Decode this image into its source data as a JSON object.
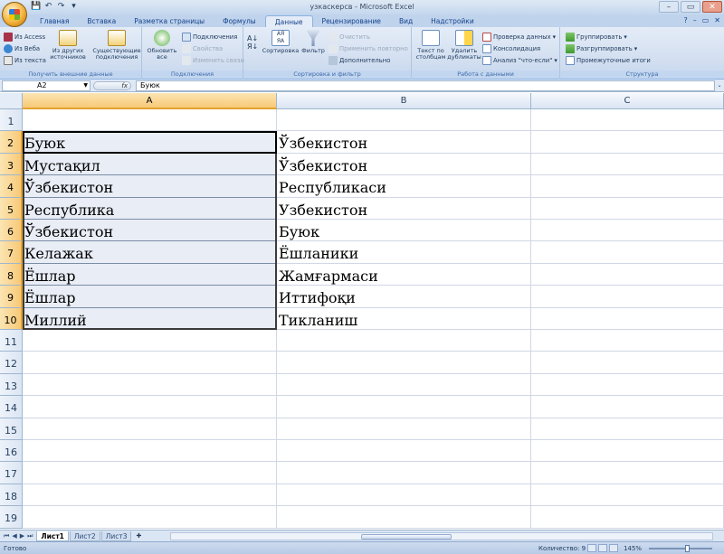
{
  "window": {
    "title": "узкаскерсв - Microsoft Excel",
    "controls": [
      "–",
      "▭",
      "✕"
    ]
  },
  "ribbon_tabs": [
    {
      "label": "Главная",
      "active": false
    },
    {
      "label": "Вставка",
      "active": false
    },
    {
      "label": "Разметка страницы",
      "active": false
    },
    {
      "label": "Формулы",
      "active": false
    },
    {
      "label": "Данные",
      "active": true
    },
    {
      "label": "Рецензирование",
      "active": false
    },
    {
      "label": "Вид",
      "active": false
    },
    {
      "label": "Надстройки",
      "active": false
    }
  ],
  "ribbon": {
    "external": {
      "label": "Получить внешние данные",
      "from_access": "Из Access",
      "from_web": "Из Веба",
      "from_text": "Из текста",
      "other_sources": "Из других источников",
      "existing": "Существующие подключения"
    },
    "connections": {
      "label": "Подключения",
      "refresh_all": "Обновить все",
      "connections": "Подключения",
      "properties": "Свойства",
      "edit_links": "Изменить связи"
    },
    "sort_filter": {
      "label": "Сортировка и фильтр",
      "sort": "Сортировка",
      "filter": "Фильтр",
      "clear": "Очистить",
      "reapply": "Применить повторно",
      "advanced": "Дополнительно"
    },
    "data_tools": {
      "label": "Работа с данными",
      "text_to_columns": "Текст по столбцам",
      "remove_duplicates": "Удалить дубликаты",
      "validation": "Проверка данных",
      "consolidate": "Консолидация",
      "whatif": "Анализ \"что-если\""
    },
    "outline": {
      "label": "Структура",
      "group": "Группировать",
      "ungroup": "Разгруппировать",
      "subtotal": "Промежуточные итоги"
    }
  },
  "formula_bar": {
    "name_box": "A2",
    "fx": "fx",
    "content": "Буюк"
  },
  "sheet": {
    "columns": [
      "A",
      "B",
      "C"
    ],
    "rows": [
      "1",
      "2",
      "3",
      "4",
      "5",
      "6",
      "7",
      "8",
      "9",
      "10",
      "11",
      "12",
      "13",
      "14",
      "15",
      "16",
      "17",
      "18",
      "19"
    ],
    "data": [
      [
        "",
        ""
      ],
      [
        "Буюк",
        "Ўзбекистон"
      ],
      [
        "Мустақил",
        "Ўзбекистон"
      ],
      [
        "Ўзбекистон",
        "Республикаси"
      ],
      [
        "Республика",
        "Узбекистон"
      ],
      [
        "Ўзбекистон",
        "Буюк"
      ],
      [
        "Келажак",
        "Ёшланики"
      ],
      [
        "Ёшлар",
        "Жамғармаси"
      ],
      [
        "Ёшлар",
        "Иттифоқи"
      ],
      [
        "Миллий",
        "Тикланиш"
      ]
    ]
  },
  "sheet_tabs": [
    {
      "label": "Лист1",
      "active": true
    },
    {
      "label": "Лист2",
      "active": false
    },
    {
      "label": "Лист3",
      "active": false
    }
  ],
  "status": {
    "ready": "Готово",
    "count": "Количество: 9",
    "zoom": "145%"
  }
}
